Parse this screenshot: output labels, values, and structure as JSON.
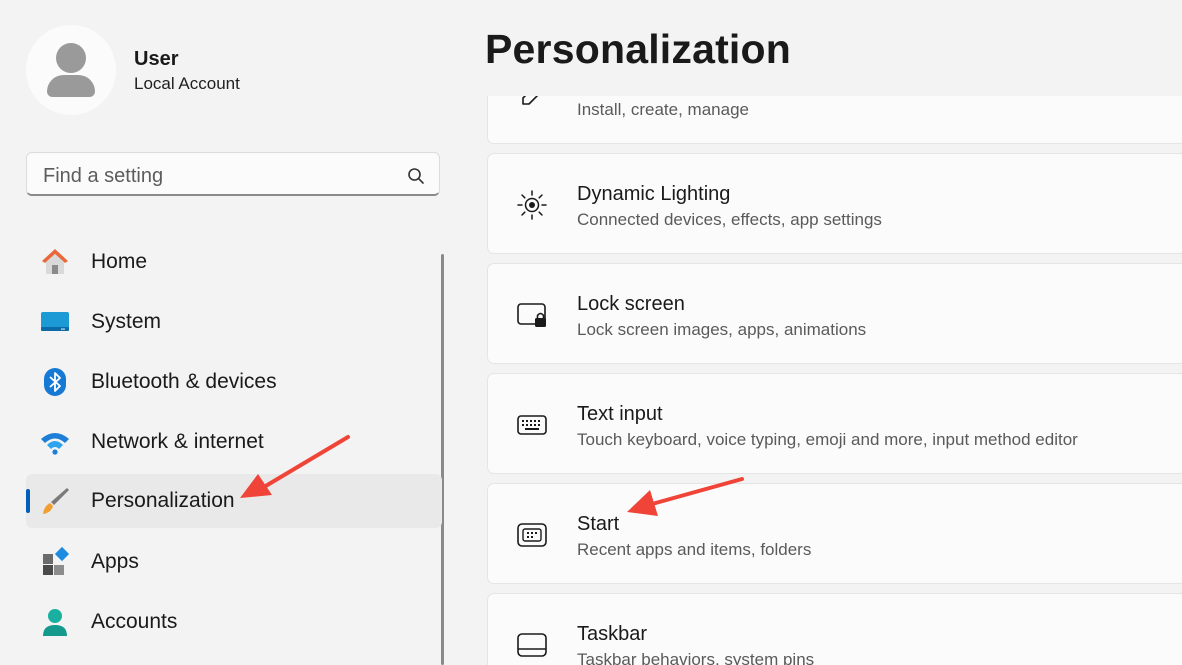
{
  "user": {
    "name": "User",
    "account_type": "Local Account"
  },
  "search": {
    "placeholder": "Find a setting"
  },
  "nav": {
    "items": [
      {
        "label": "Home",
        "icon": "home-icon"
      },
      {
        "label": "System",
        "icon": "system-icon"
      },
      {
        "label": "Bluetooth & devices",
        "icon": "bluetooth-icon"
      },
      {
        "label": "Network & internet",
        "icon": "wifi-icon"
      },
      {
        "label": "Personalization",
        "icon": "paintbrush-icon",
        "selected": true
      },
      {
        "label": "Apps",
        "icon": "apps-icon"
      },
      {
        "label": "Accounts",
        "icon": "person-icon"
      }
    ]
  },
  "page": {
    "title": "Personalization"
  },
  "cards": [
    {
      "title": "",
      "subtitle": "Install, create, manage",
      "icon": "pen-icon"
    },
    {
      "title": "Dynamic Lighting",
      "subtitle": "Connected devices, effects, app settings",
      "icon": "dynamic-lighting-icon"
    },
    {
      "title": "Lock screen",
      "subtitle": "Lock screen images, apps, animations",
      "icon": "lock-screen-icon"
    },
    {
      "title": "Text input",
      "subtitle": "Touch keyboard, voice typing, emoji and more, input method editor",
      "icon": "keyboard-icon"
    },
    {
      "title": "Start",
      "subtitle": "Recent apps and items, folders",
      "icon": "start-icon"
    },
    {
      "title": "Taskbar",
      "subtitle": "Taskbar behaviors, system pins",
      "icon": "taskbar-icon"
    }
  ],
  "colors": {
    "accent": "#005fb8",
    "annotation_arrow": "#f04438"
  }
}
